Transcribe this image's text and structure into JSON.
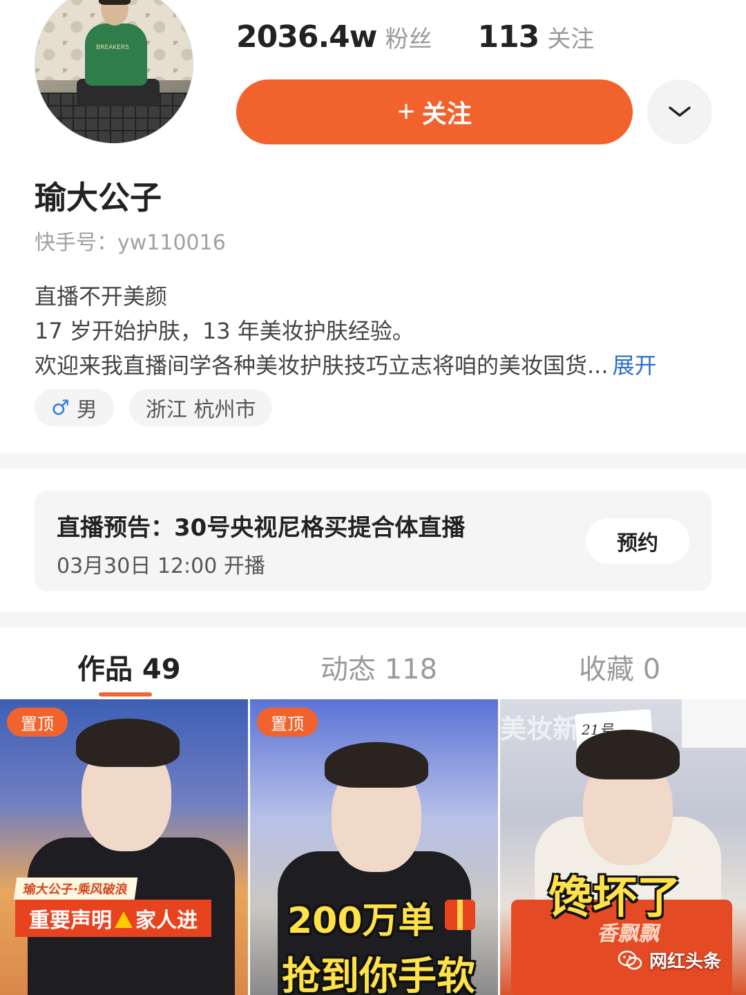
{
  "profile": {
    "fans_count": "2036.4w",
    "fans_label": "粉丝",
    "following_count": "113",
    "following_label": "关注",
    "follow_button_label": "关注",
    "name": "瑜大公子",
    "kuaishou_id": "快手号：yw110016",
    "bio": {
      "line1": "直播不开美颜",
      "line2": "17 岁开始护肤，13 年美妆护肤经验。",
      "line3": "欢迎来我直播间学各种美妆护肤技巧立志将咱的美妆国货...",
      "expand_label": "展开"
    },
    "tags": {
      "gender_symbol": "♂",
      "gender": "男",
      "location": "浙江 杭州市"
    }
  },
  "live_notice": {
    "title": "直播预告：30号央视尼格买提合体直播",
    "time": "03月30日 12:00 开播",
    "reserve_label": "预约"
  },
  "tabs": [
    {
      "label": "作品 49",
      "active": true
    },
    {
      "label": "动态 118",
      "active": false
    },
    {
      "label": "收藏 0",
      "active": false
    }
  ],
  "videos": [
    {
      "pin_label": "置顶",
      "caption_small": "瑜大公子·乘风破浪",
      "caption_main_a": "重要声明",
      "caption_main_b": "家人进"
    },
    {
      "pin_label": "置顶",
      "caption_line1": "200万单",
      "caption_line2": "抢到你手软"
    },
    {
      "caption": "馋坏了",
      "sign_text": "21号",
      "brand_text": "香飘飘"
    }
  ],
  "watermark": "网红头条",
  "colors": {
    "accent": "#f2622c",
    "link": "#2c6fc9",
    "male": "#2f7fe0"
  },
  "icons": [
    "plus-icon",
    "chevron-down-icon",
    "male-icon",
    "warning-icon",
    "gift-icon",
    "wechat-icon"
  ]
}
